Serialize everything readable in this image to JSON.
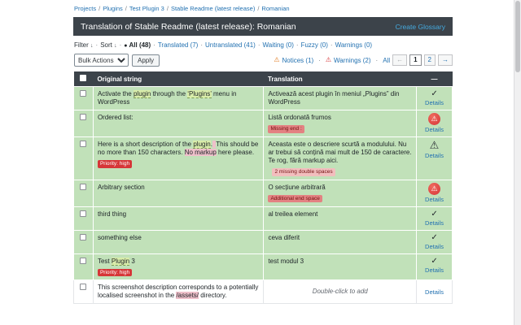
{
  "breadcrumb": {
    "separator": "/",
    "items": [
      "Projects",
      "Plugins",
      "Test Plugin 3",
      "Stable Readme (latest release)",
      "Romanian"
    ]
  },
  "header": {
    "title": "Translation of Stable Readme (latest release): Romanian",
    "create_glossary": "Create Glossary"
  },
  "filters": {
    "filter_label": "Filter",
    "sort_label": "Sort",
    "separator": "·",
    "tabs": [
      {
        "label": "All (48)"
      },
      {
        "label": "Translated (7)"
      },
      {
        "label": "Untranslated (41)"
      },
      {
        "label": "Waiting (0)"
      },
      {
        "label": "Fuzzy (0)"
      },
      {
        "label": "Warnings (0)"
      }
    ]
  },
  "bulk": {
    "select_value": "Bulk Actions",
    "apply_label": "Apply",
    "notices_label": "Notices (1)",
    "warnings_label": "Warnings (2)",
    "all_label": "All",
    "pages": [
      "1",
      "2"
    ]
  },
  "icons": {
    "warning": "⚠",
    "check": "✓",
    "caret_down": "↓",
    "prev": "←",
    "next": "→",
    "bullet": "●",
    "dash": "—"
  },
  "colors": {
    "accent_link": "#2271b1",
    "row_translated_green": "#c1e1b9",
    "header_dark": "#3c434a",
    "priority_red": "#d63638",
    "notice_orange": "#e17b21"
  },
  "table": {
    "headers": {
      "original": "Original string",
      "translation": "Translation",
      "actions": "—"
    },
    "rows": [
      {
        "o1": "Activate the ",
        "o2": "plugin",
        "o3": " through the ",
        "o4": "‘Plugins’",
        "o5": " menu in WordPress",
        "t1": "Activează acest plugin în meniul „Plugins” din WordPress",
        "details": "Details"
      },
      {
        "o1": "Ordered list:",
        "t1": "Listă ordonată frumos",
        "warning": "Missing end :",
        "details": "Details"
      },
      {
        "o1": "Here is a short description of the ",
        "o2": "plugin",
        "o3": ".",
        "sp1": "  ",
        "o4": "This should be no more than 150 characters. ",
        "o5": "No markup",
        "o6": " here please.",
        "priority": "Priority: high",
        "t1": "Aceasta este o descriere scurtă a modulului. Nu ar trebui să conțină mai mult de 150 de caractere. Te rog, fără markup aici.",
        "warning": "2 missing double spaces",
        "details": "Details"
      },
      {
        "o1": "Arbitrary section",
        "t1": "O secțiune arbitrară",
        "warning": "Additional end space",
        "details": "Details"
      },
      {
        "o1": "third thing",
        "t1": "al treilea element",
        "details": "Details"
      },
      {
        "o1": "something else",
        "t1": "ceva diferit",
        "details": "Details"
      },
      {
        "o1": "Test ",
        "o2": "Plugin",
        "o3": " 3",
        "priority": "Priority: high",
        "t1": "test modul 3",
        "details": "Details"
      },
      {
        "o1": "This screenshot description corresponds to a potentially localised screenshot in the ",
        "o2": "/assets/",
        "o3": " directory.",
        "t1": "Double-click to add",
        "details": "Details"
      }
    ]
  }
}
